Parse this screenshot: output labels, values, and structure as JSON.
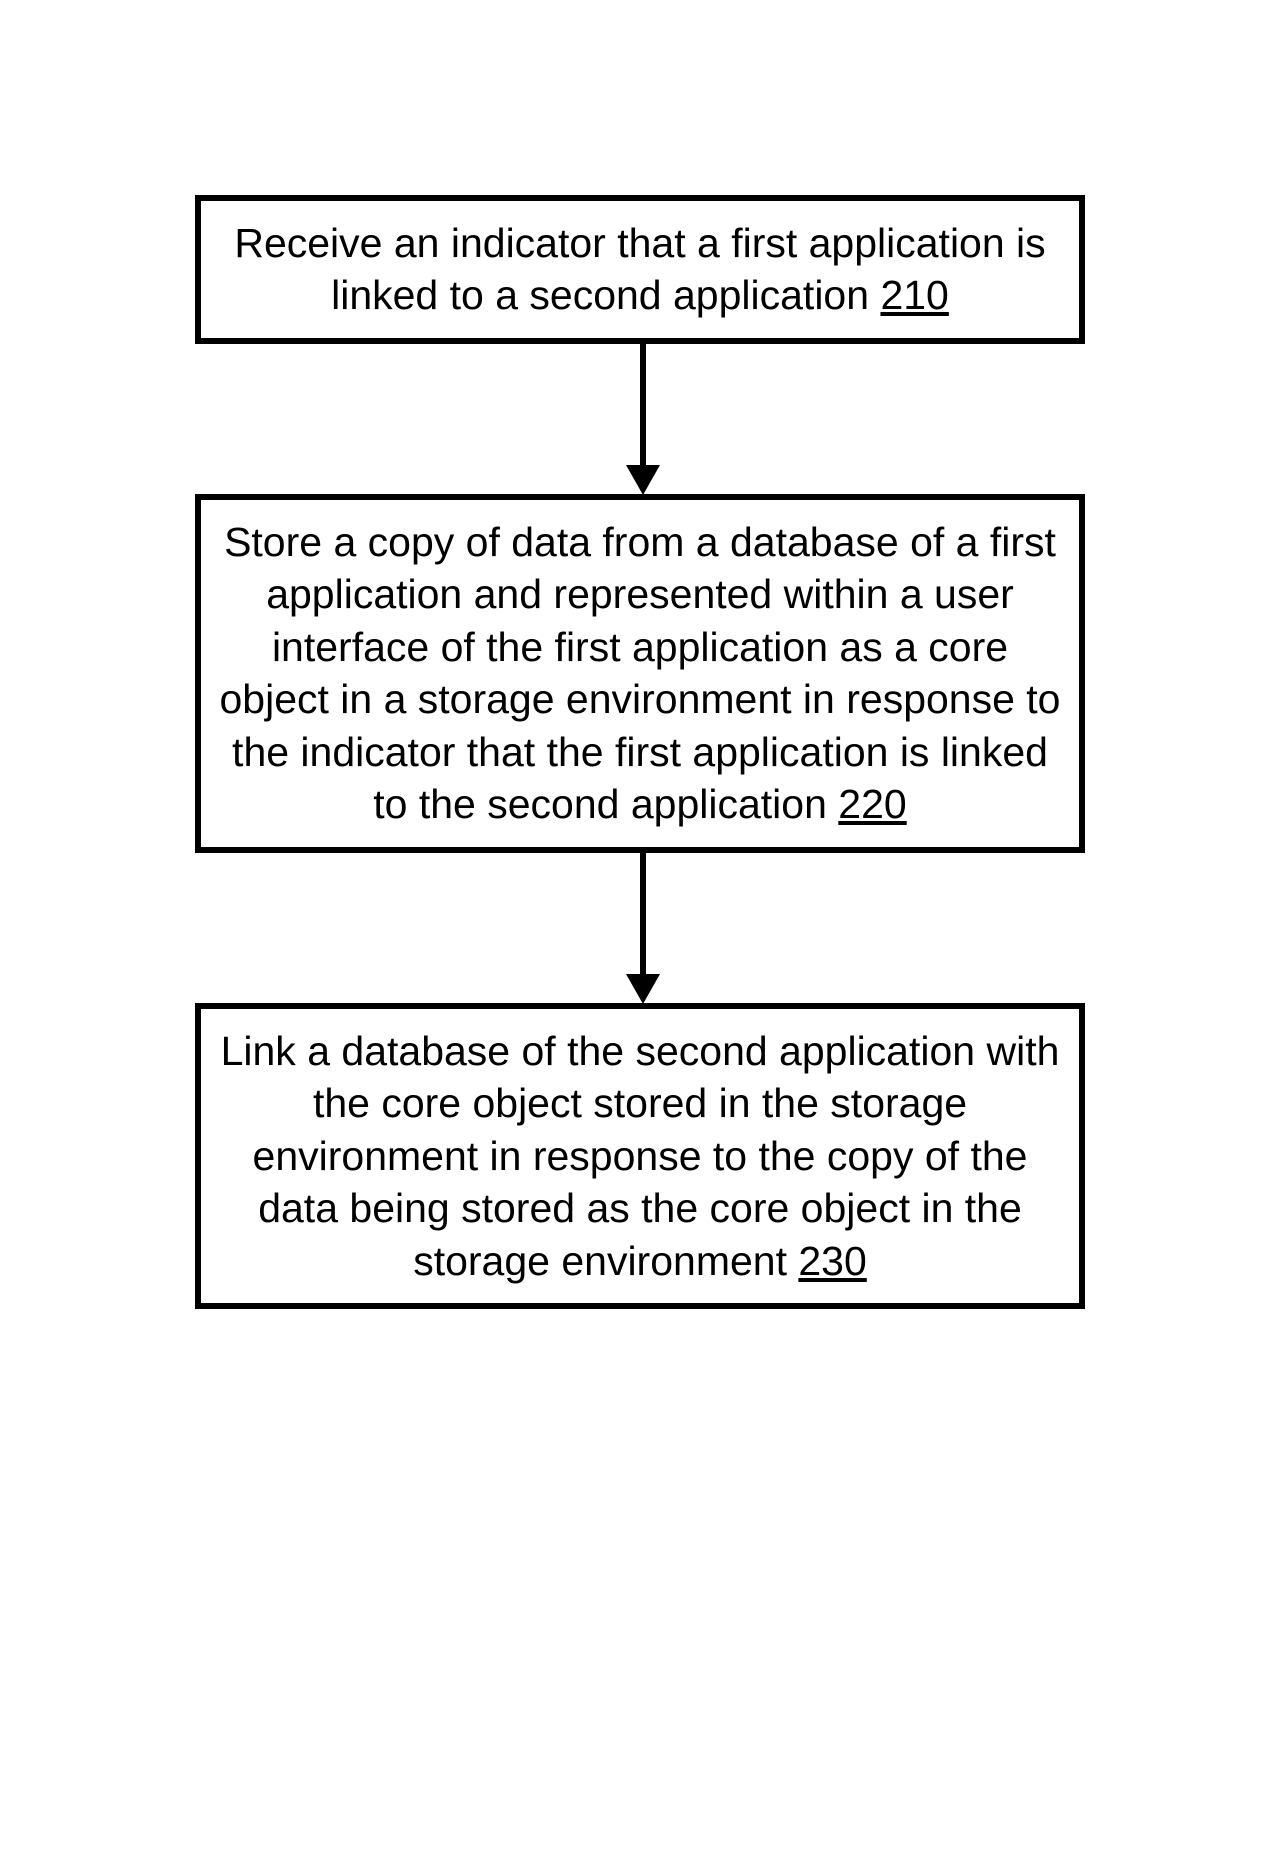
{
  "flowchart": {
    "boxes": [
      {
        "text": "Receive an indicator that a first application is linked to a second application",
        "ref": "210"
      },
      {
        "text": "Store a copy of data from a database of a first application and represented within a user interface of the first application as a core object in a storage environment in response to the indicator that the first application is linked to the second application",
        "ref": "220"
      },
      {
        "text": "Link a database of the second application with the core object stored in the storage environment in response to the copy of the data being stored as the core object in the storage environment",
        "ref": "230"
      }
    ]
  }
}
